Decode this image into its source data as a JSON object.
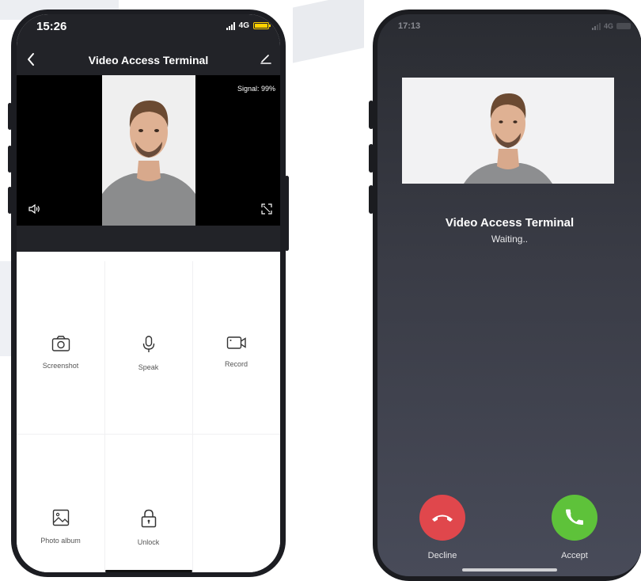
{
  "left_phone": {
    "status": {
      "time": "15:26",
      "network": "4G"
    },
    "nav": {
      "title": "Video Access Terminal"
    },
    "video": {
      "signal": "Signal: 99%"
    },
    "actions": [
      {
        "label": "Screenshot",
        "icon": "camera-icon"
      },
      {
        "label": "Speak",
        "icon": "microphone-icon"
      },
      {
        "label": "Record",
        "icon": "video-camera-icon"
      },
      {
        "label": "Photo album",
        "icon": "image-icon"
      },
      {
        "label": "Unlock",
        "icon": "lock-icon"
      }
    ]
  },
  "right_phone": {
    "status": {
      "time": "17:13",
      "network": "4G"
    },
    "caller": {
      "name": "Video Access Terminal",
      "status": "Waiting.."
    },
    "decline": {
      "label": "Decline",
      "color": "#e0474c"
    },
    "accept": {
      "label": "Accept",
      "color": "#5ec23a"
    }
  }
}
